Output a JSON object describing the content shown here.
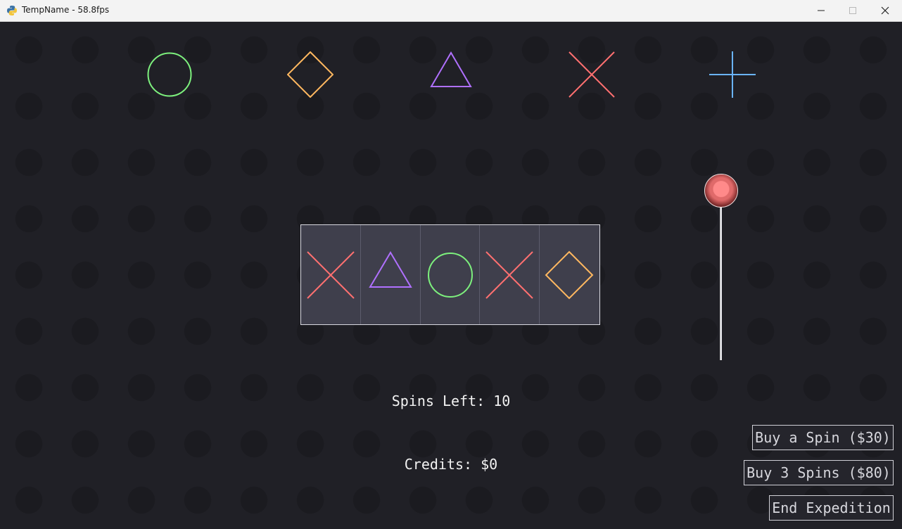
{
  "window": {
    "title": "TempName - 58.8fps"
  },
  "icons": {
    "app": "python-icon",
    "minimize": "minimize-icon",
    "maximize": "maximize-icon",
    "close": "close-icon"
  },
  "paytable": {
    "symbols": [
      "circle",
      "diamond",
      "triangle",
      "cross",
      "plus"
    ]
  },
  "reels": {
    "symbols": [
      "cross",
      "triangle",
      "circle",
      "cross",
      "diamond"
    ]
  },
  "hud": {
    "spins_left": "Spins Left: 10",
    "credits": "Credits: $0"
  },
  "buttons": {
    "buy_spin": "Buy a Spin ($30)",
    "buy_three": "Buy 3 Spins ($80)",
    "end_expedition": "End Expedition"
  },
  "colors": {
    "circle": "#7df07d",
    "diamond": "#ffb860",
    "triangle": "#b070ff",
    "cross": "#ff7070",
    "plus": "#6ab4ff",
    "background": "#202026",
    "reel_panel": "#3f3f4c"
  }
}
